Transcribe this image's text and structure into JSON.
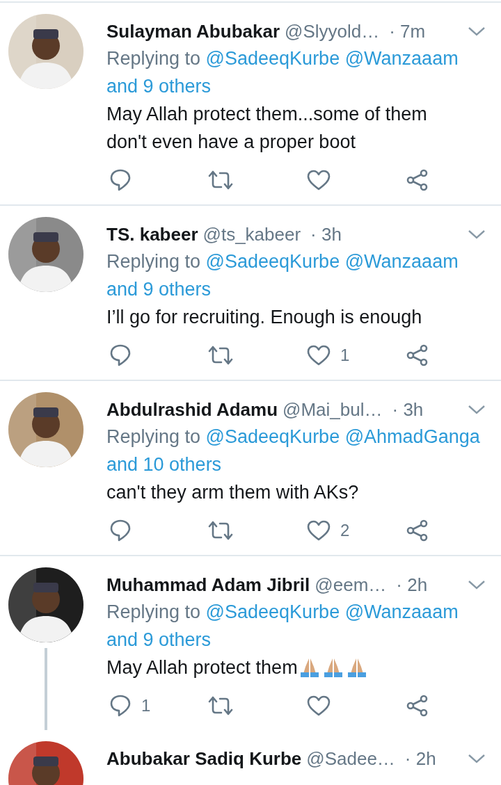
{
  "tweets": [
    {
      "name": "Sulayman Abubakar",
      "handle": "@Slyyold…",
      "time": "· 7m",
      "replying": {
        "prefix": "Replying to",
        "mentions": [
          "@SadeeqKurbe",
          "@Wanzaaam",
          "and 9 others"
        ]
      },
      "body": [
        "May Allah protect them...some of them don't even have a proper boot"
      ],
      "actions": [
        {
          "kind": "reply"
        },
        {
          "kind": "retweet"
        },
        {
          "kind": "like"
        },
        {
          "kind": "share"
        }
      ]
    },
    {
      "name": "TS. kabeer",
      "handle": "@ts_kabeer",
      "time": "· 3h",
      "replying": {
        "prefix": "Replying to",
        "mentions": [
          "@SadeeqKurbe",
          "@Wanzaaam",
          "and 9 others"
        ]
      },
      "body": [
        "I’ll go for recruiting.  Enough is enough"
      ],
      "actions": [
        {
          "kind": "reply"
        },
        {
          "kind": "retweet"
        },
        {
          "kind": "like",
          "count": "1"
        },
        {
          "kind": "share"
        }
      ]
    },
    {
      "name": "Abdulrashid Adamu",
      "handle": "@Mai_bul…",
      "time": "· 3h",
      "replying": {
        "prefix": "Replying to",
        "mentions": [
          "@SadeeqKurbe",
          "@AhmadGanga",
          "and 10 others"
        ]
      },
      "body": [
        "can't they arm them with AKs?"
      ],
      "actions": [
        {
          "kind": "reply"
        },
        {
          "kind": "retweet"
        },
        {
          "kind": "like",
          "count": "2"
        },
        {
          "kind": "share"
        }
      ]
    },
    {
      "name": "Muhammad Adam Jibril",
      "handle": "@eem…",
      "time": "· 2h",
      "replying": {
        "prefix": "Replying to",
        "mentions": [
          "@SadeeqKurbe",
          "@Wanzaaam",
          "and 9 others"
        ]
      },
      "body": [
        "May Allah protect them"
      ],
      "emoji": [
        {
          "kind": "praying_hands"
        },
        {
          "kind": "praying_hands"
        },
        {
          "kind": "praying_hands"
        }
      ],
      "actions": [
        {
          "kind": "reply",
          "count": "1"
        },
        {
          "kind": "retweet"
        },
        {
          "kind": "like"
        },
        {
          "kind": "share"
        }
      ],
      "thread_continues": true
    },
    {
      "name": "Abubakar Sadiq Kurbe",
      "handle": "@Sadee…",
      "time": "· 2h"
    }
  ]
}
